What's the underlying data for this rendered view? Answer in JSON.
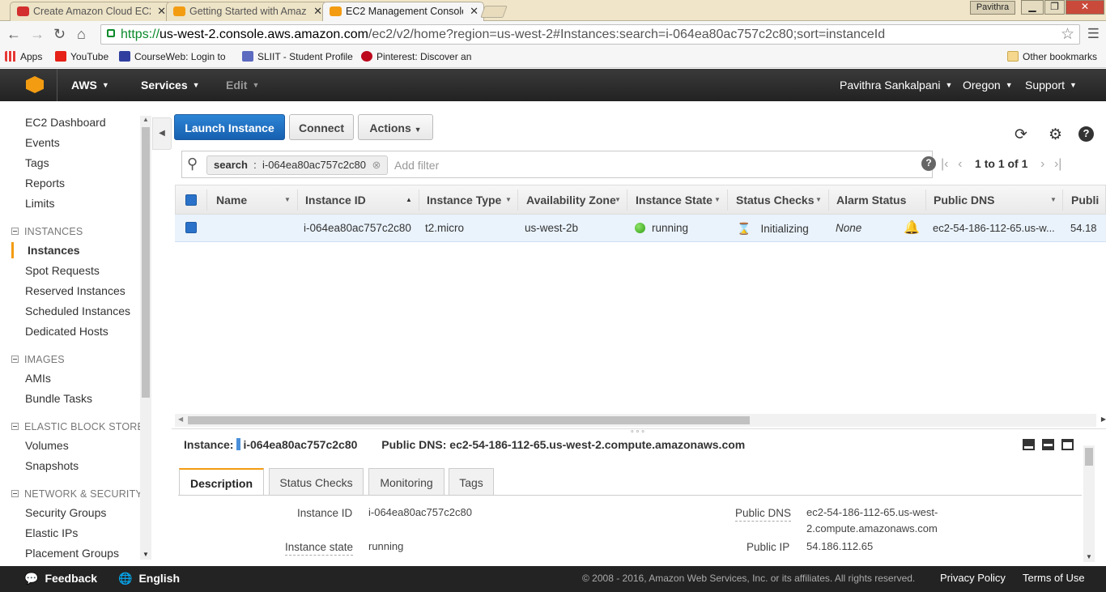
{
  "browser": {
    "tabs": [
      {
        "title": "Create Amazon Cloud EC2",
        "favicon_color": "#d32f2f"
      },
      {
        "title": "Getting Started with Amaz",
        "favicon_color": "#f39c12"
      },
      {
        "title": "EC2 Management Console",
        "favicon_color": "#f39c12"
      }
    ],
    "profile_name": "Pavithra",
    "url_scheme": "https://",
    "url_host": "us-west-2.console.aws.amazon.com",
    "url_path": "/ec2/v2/home?region=us-west-2#Instances:search=i-064ea80ac757c2c80;sort=instanceId",
    "bookmarks": [
      {
        "label": "Apps",
        "color": "#e53935"
      },
      {
        "label": "YouTube",
        "color": "#e62117"
      },
      {
        "label": "CourseWeb: Login to",
        "color": "#303f9f"
      },
      {
        "label": "SLIIT - Student Profile",
        "color": "#5c6bc0"
      },
      {
        "label": "Pinterest: Discover an",
        "color": "#bd081c"
      }
    ],
    "other_bookmarks": "Other bookmarks"
  },
  "aws_nav": {
    "brand": "AWS",
    "services": "Services",
    "edit": "Edit",
    "user": "Pavithra Sankalpani",
    "region": "Oregon",
    "support": "Support"
  },
  "sidebar": {
    "top_items": [
      "EC2 Dashboard",
      "Events",
      "Tags",
      "Reports",
      "Limits"
    ],
    "sections": [
      {
        "title": "INSTANCES",
        "items": [
          "Instances",
          "Spot Requests",
          "Reserved Instances",
          "Scheduled Instances",
          "Dedicated Hosts"
        ]
      },
      {
        "title": "IMAGES",
        "items": [
          "AMIs",
          "Bundle Tasks"
        ]
      },
      {
        "title": "ELASTIC BLOCK STORE",
        "items": [
          "Volumes",
          "Snapshots"
        ]
      },
      {
        "title": "NETWORK & SECURITY",
        "items": [
          "Security Groups",
          "Elastic IPs",
          "Placement Groups"
        ]
      }
    ],
    "selected": "Instances"
  },
  "toolbar": {
    "launch": "Launch Instance",
    "connect": "Connect",
    "actions": "Actions"
  },
  "search": {
    "chip_key": "search",
    "chip_value": "i-064ea80ac757c2c80",
    "placeholder": "Add filter",
    "pager": "1 to 1 of 1"
  },
  "table": {
    "columns": [
      "Name",
      "Instance ID",
      "Instance Type",
      "Availability Zone",
      "Instance State",
      "Status Checks",
      "Alarm Status",
      "Public DNS",
      "Publi"
    ],
    "row": {
      "name": "",
      "instance_id": "i-064ea80ac757c2c80",
      "instance_type": "t2.micro",
      "availability_zone": "us-west-2b",
      "instance_state": "running",
      "status_checks": "Initializing",
      "alarm_status": "None",
      "public_dns": "ec2-54-186-112-65.us-w...",
      "public_ip": "54.18"
    }
  },
  "details": {
    "instance_label": "Instance:",
    "instance_id": "i-064ea80ac757c2c80",
    "dns_label": "Public DNS:",
    "dns_value": "ec2-54-186-112-65.us-west-2.compute.amazonaws.com",
    "tabs": [
      "Description",
      "Status Checks",
      "Monitoring",
      "Tags"
    ],
    "fields": {
      "instance_id_label": "Instance ID",
      "instance_id_value": "i-064ea80ac757c2c80",
      "instance_state_label": "Instance state",
      "instance_state_value": "running",
      "public_dns_label": "Public DNS",
      "public_dns_value_1": "ec2-54-186-112-65.us-west-",
      "public_dns_value_2": "2.compute.amazonaws.com",
      "public_ip_label": "Public IP",
      "public_ip_value": "54.186.112.65"
    }
  },
  "footer": {
    "feedback": "Feedback",
    "language": "English",
    "copyright": "© 2008 - 2016, Amazon Web Services, Inc. or its affiliates. All rights reserved.",
    "privacy": "Privacy Policy",
    "terms": "Terms of Use"
  }
}
